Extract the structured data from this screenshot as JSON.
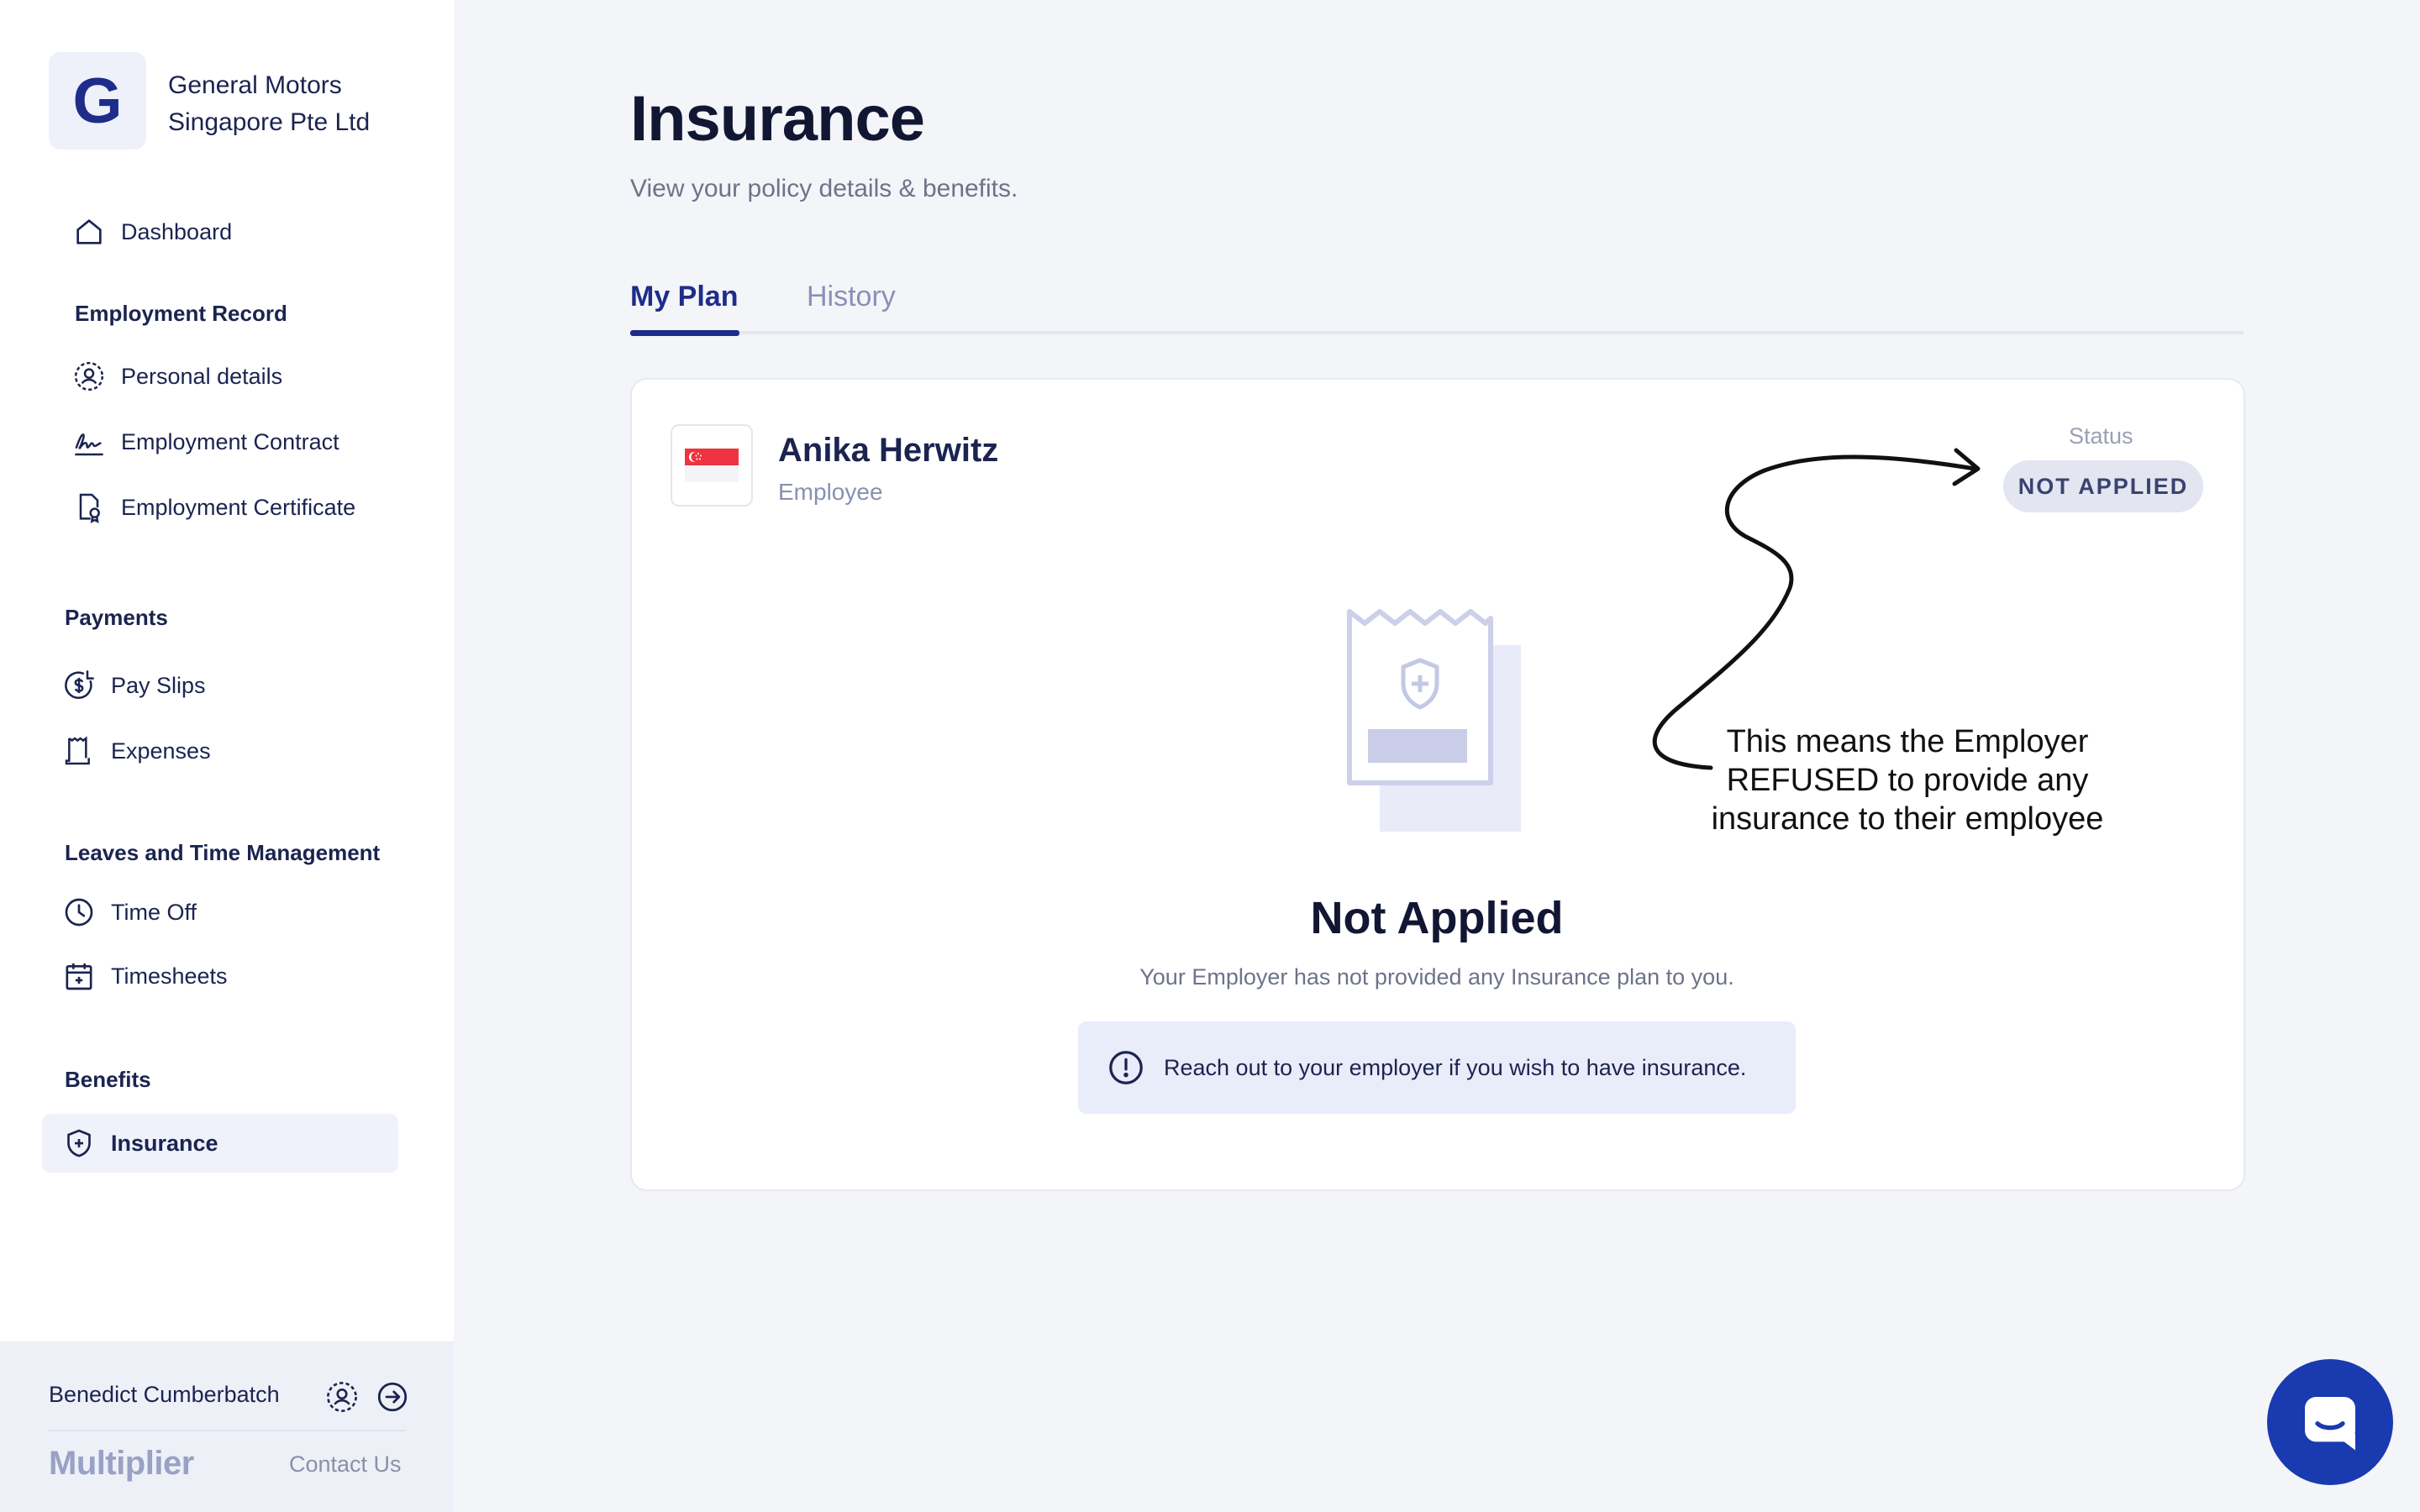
{
  "company": {
    "logo_letter": "G",
    "name_line1": "General Motors",
    "name_line2": "Singapore Pte Ltd"
  },
  "sidebar": {
    "dashboard": "Dashboard",
    "employment_record": {
      "title": "Employment Record",
      "items": [
        "Personal details",
        "Employment Contract",
        "Employment Certificate"
      ]
    },
    "payments": {
      "title": "Payments",
      "items": [
        "Pay Slips",
        "Expenses"
      ]
    },
    "leaves": {
      "title": "Leaves and Time Management",
      "items": [
        "Time Off",
        "Timesheets"
      ]
    },
    "benefits": {
      "title": "Benefits",
      "items": [
        "Insurance"
      ]
    },
    "active_item": "Insurance"
  },
  "user": {
    "name": "Benedict Cumberbatch",
    "brand": "Multiplier",
    "contact": "Contact Us"
  },
  "page": {
    "title": "Insurance",
    "subtitle": "View your policy details & benefits."
  },
  "tabs": [
    {
      "label": "My Plan",
      "active": true
    },
    {
      "label": "History",
      "active": false
    }
  ],
  "plan_card": {
    "employee_name": "Anika Herwitz",
    "employee_role": "Employee",
    "status_label": "Status",
    "status_value": "NOT APPLIED",
    "empty_title": "Not Applied",
    "empty_subtitle": "Your Employer has not provided any Insurance plan to you.",
    "info_message": "Reach out to your employer if you wish to have insurance."
  },
  "annotation": {
    "line1": "This means the Employer",
    "line2": "REFUSED to provide any",
    "line3": "insurance to their employee"
  },
  "icons": {
    "dashboard": "home-icon",
    "personal": "user-circle-icon",
    "contract": "signature-icon",
    "certificate": "certificate-icon",
    "payslips": "dollar-circle-icon",
    "expenses": "receipt-icon",
    "timeoff": "clock-icon",
    "timesheets": "calendar-plus-icon",
    "insurance": "shield-plus-icon",
    "chat": "chat-icon",
    "logout": "arrow-right-circle-icon"
  },
  "colors": {
    "accent": "#1e2d8a",
    "chat_button": "#1a3ab0",
    "status_pill": "#e3e6f0"
  }
}
